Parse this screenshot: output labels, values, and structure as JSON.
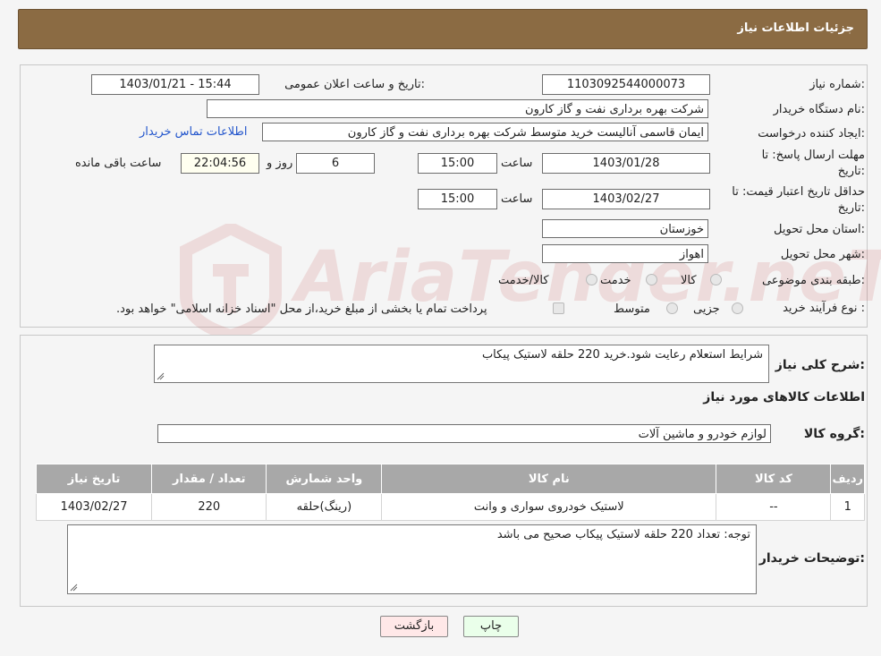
{
  "header": {
    "title": "جزئیات اطلاعات نیاز"
  },
  "form": {
    "need_number_label": "شماره نیاز:",
    "need_number": "1103092544000073",
    "announce_label": "تاریخ و ساعت اعلان عمومی:",
    "announce_value": "1403/01/21 - 15:44",
    "buyer_org_label": "نام دستگاه خریدار:",
    "buyer_org": "شرکت بهره برداری نفت و گاز کارون",
    "creator_label": "ایجاد کننده درخواست:",
    "creator": "ایمان قاسمی آنالیست خرید متوسط شرکت بهره برداری نفت و گاز کارون",
    "contact_link": "اطلاعات تماس خریدار",
    "deadline_label_1": "مهلت ارسال پاسخ: تا",
    "deadline_label_2": "تاریخ:",
    "deadline_date": "1403/01/28",
    "time_label": "ساعت",
    "deadline_time": "15:00",
    "days_value": "6",
    "days_label": "روز و",
    "remaining_time": "22:04:56",
    "remaining_label": "ساعت باقی مانده",
    "validity_label_1": "حداقل تاریخ اعتبار قیمت: تا",
    "validity_label_2": "تاریخ:",
    "validity_date": "1403/02/27",
    "validity_time_label": "ساعت",
    "validity_time": "15:00",
    "province_label": "استان محل تحویل:",
    "province": "خوزستان",
    "city_label": "شهر محل تحویل:",
    "city": "اهواز",
    "category_label": "طبقه بندی موضوعی:",
    "category_options": [
      "کالا",
      "خدمت",
      "کالا/خدمت"
    ],
    "process_label": "نوع فرآیند خرید :",
    "process_options": [
      "جزیی",
      "متوسط"
    ],
    "process_note": "پرداخت تمام یا بخشی از مبلغ خرید،از محل \"اسناد خزانه اسلامی\" خواهد بود."
  },
  "details": {
    "summary_label": "شرح کلی نیاز:",
    "summary": "شرایط استعلام رعایت شود.خرید 220 حلقه لاستیک پیکاب",
    "items_title": "اطلاعات کالاهای مورد نیاز",
    "group_label": "گروه کالا:",
    "group_value": "لوازم خودرو و ماشین آلات",
    "table": {
      "headers": [
        "ردیف",
        "کد کالا",
        "نام کالا",
        "واحد شمارش",
        "تعداد / مقدار",
        "تاریخ نیاز"
      ],
      "rows": [
        [
          "1",
          "--",
          "لاستیک خودروی سواری و وانت",
          "(رینگ)حلقه",
          "220",
          "1403/02/27"
        ]
      ]
    },
    "buyer_notes_label": "توضیحات خریدار:",
    "buyer_notes": "توجه: تعداد 220 حلقه لاستیک پیکاب صحیح می باشد"
  },
  "buttons": {
    "print": "چاپ",
    "back": "بازگشت"
  },
  "watermark": {
    "text": "AriaTender.neT"
  },
  "colors": {
    "header_bg": "#8b6b43",
    "table_header_bg": "#a8a8a8",
    "print_btn_bg": "#eaffea",
    "back_btn_bg": "#ffe8e8",
    "link": "#2255cc"
  }
}
